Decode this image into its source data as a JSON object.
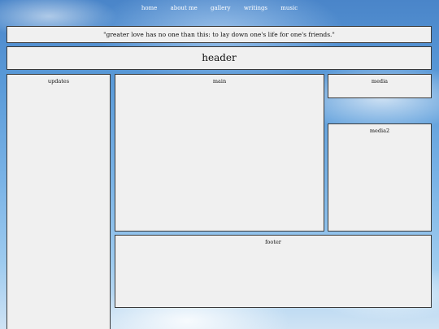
{
  "nav": {
    "items": [
      "home",
      "about me",
      "gallery",
      "writings",
      "music"
    ]
  },
  "quote": {
    "text": "\"greater love has no one than this: to lay down one's life for one's friends.\""
  },
  "header": {
    "title": "header"
  },
  "panels": {
    "updates": "updates",
    "main": "main",
    "media": "media",
    "media2": "media2",
    "footer": "footer"
  }
}
